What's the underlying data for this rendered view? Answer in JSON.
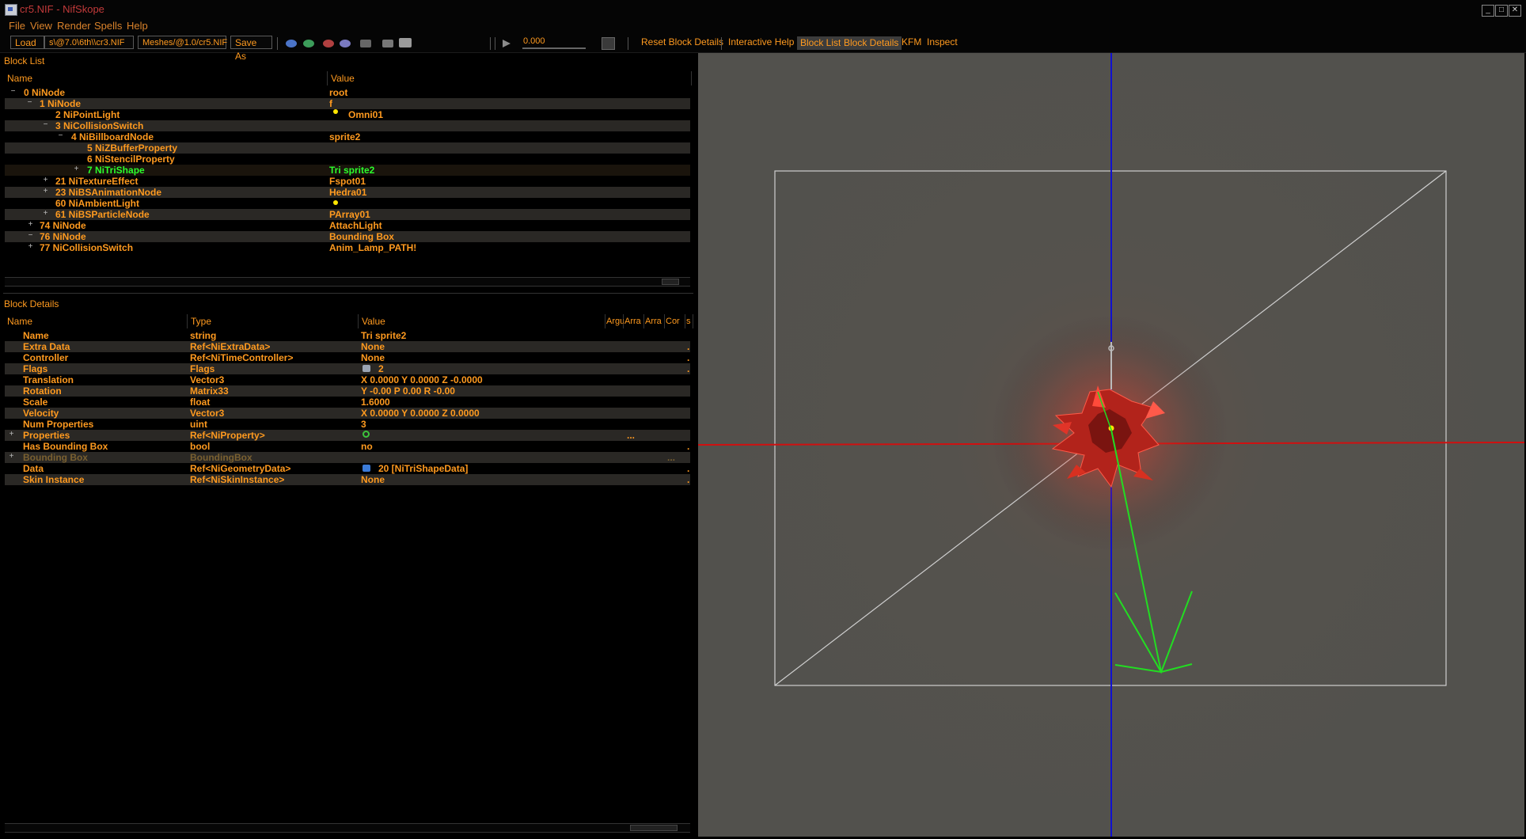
{
  "window": {
    "title": "cr5.NIF - NifSkope",
    "buttons": {
      "minimize": "_",
      "maximize": "□",
      "close": "✕"
    }
  },
  "menu": [
    "File",
    "View",
    "Render",
    "Spells",
    "Help"
  ],
  "toolbar": {
    "load_label": "Load",
    "load_path": "s\\@7.0\\6th\\\\cr3.NIF",
    "save_path": "Meshes/@1.0/cr5.NIF",
    "save_as_label": "Save As",
    "time_value": "0.000",
    "reset_block_details": "Reset Block Details",
    "interactive_help": "Interactive Help",
    "block_list": "Block List",
    "block_details": "Block Details",
    "kfm": "KFM",
    "inspect": "Inspect"
  },
  "block_list": {
    "title": "Block List",
    "columns": {
      "name": "Name",
      "value": "Value"
    },
    "rows": [
      {
        "name": "0 NiNode",
        "value": "root",
        "expander": "−"
      },
      {
        "name": "1 NiNode",
        "value": "f",
        "expander": "−"
      },
      {
        "name": "2 NiPointLight",
        "value": "Omni01",
        "expander": ""
      },
      {
        "name": "3 NiCollisionSwitch",
        "value": "",
        "expander": "−"
      },
      {
        "name": "4 NiBillboardNode",
        "value": "sprite2",
        "expander": "−"
      },
      {
        "name": "5 NiZBufferProperty",
        "value": "",
        "expander": ""
      },
      {
        "name": "6 NiStencilProperty",
        "value": "",
        "expander": ""
      },
      {
        "name": "7 NiTriShape",
        "value": "Tri sprite2",
        "expander": "+"
      },
      {
        "name": "21 NiTextureEffect",
        "value": "Fspot01",
        "expander": "+"
      },
      {
        "name": "23 NiBSAnimationNode",
        "value": "Hedra01",
        "expander": "+"
      },
      {
        "name": "60 NiAmbientLight",
        "value": "",
        "expander": ""
      },
      {
        "name": "61 NiBSParticleNode",
        "value": "PArray01",
        "expander": "+"
      },
      {
        "name": "74 NiNode",
        "value": "AttachLight",
        "expander": "+"
      },
      {
        "name": "76 NiNode",
        "value": "Bounding Box",
        "expander": "−"
      },
      {
        "name": "77 NiCollisionSwitch",
        "value": "Anim_Lamp_PATH!",
        "expander": "+"
      }
    ]
  },
  "block_details": {
    "title": "Block Details",
    "columns": {
      "name": "Name",
      "type": "Type",
      "value": "Value",
      "arg": "Argu",
      "arr1": "Arra",
      "arr2": "Arra",
      "cond": "Cor",
      "since": "s"
    },
    "rows": [
      {
        "name": "Name",
        "type": "string",
        "value": "Tri sprite2",
        "expander": "",
        "tail": ""
      },
      {
        "name": "Extra Data",
        "type": "Ref<NiExtraData>",
        "value": "None",
        "expander": "",
        "tail": "."
      },
      {
        "name": "Controller",
        "type": "Ref<NiTimeController>",
        "value": "None",
        "expander": "",
        "tail": "."
      },
      {
        "name": "Flags",
        "type": "Flags",
        "value": "2",
        "expander": "",
        "tail": "."
      },
      {
        "name": "Translation",
        "type": "Vector3",
        "value": "X 0.0000 Y 0.0000 Z -0.0000",
        "expander": "",
        "tail": ""
      },
      {
        "name": "Rotation",
        "type": "Matrix33",
        "value": "Y -0.00 P 0.00 R -0.00",
        "expander": "",
        "tail": ""
      },
      {
        "name": "Scale",
        "type": "float",
        "value": "1.6000",
        "expander": "",
        "tail": ""
      },
      {
        "name": "Velocity",
        "type": "Vector3",
        "value": "X 0.0000 Y 0.0000 Z 0.0000",
        "expander": "",
        "tail": ""
      },
      {
        "name": "Num Properties",
        "type": "uint",
        "value": "3",
        "expander": "",
        "tail": ""
      },
      {
        "name": "Properties",
        "type": "Ref<NiProperty>",
        "value": "",
        "expander": "+",
        "tail": "..."
      },
      {
        "name": "Has Bounding Box",
        "type": "bool",
        "value": "no",
        "expander": "",
        "tail": "."
      },
      {
        "name": "Bounding Box",
        "type": "BoundingBox",
        "value": "",
        "expander": "+",
        "tail": "..."
      },
      {
        "name": "Data",
        "type": "Ref<NiGeometryData>",
        "value": "20 [NiTriShapeData]",
        "expander": "",
        "tail": "."
      },
      {
        "name": "Skin Instance",
        "type": "Ref<NiSkinInstance>",
        "value": "None",
        "expander": "",
        "tail": "."
      }
    ]
  },
  "colors": {
    "accent_text": "#ff9a1f",
    "selected_text": "#2cff2c",
    "axis_x": "#d01010",
    "axis_y": "#1010d0",
    "axis_z": "#22dd22"
  }
}
